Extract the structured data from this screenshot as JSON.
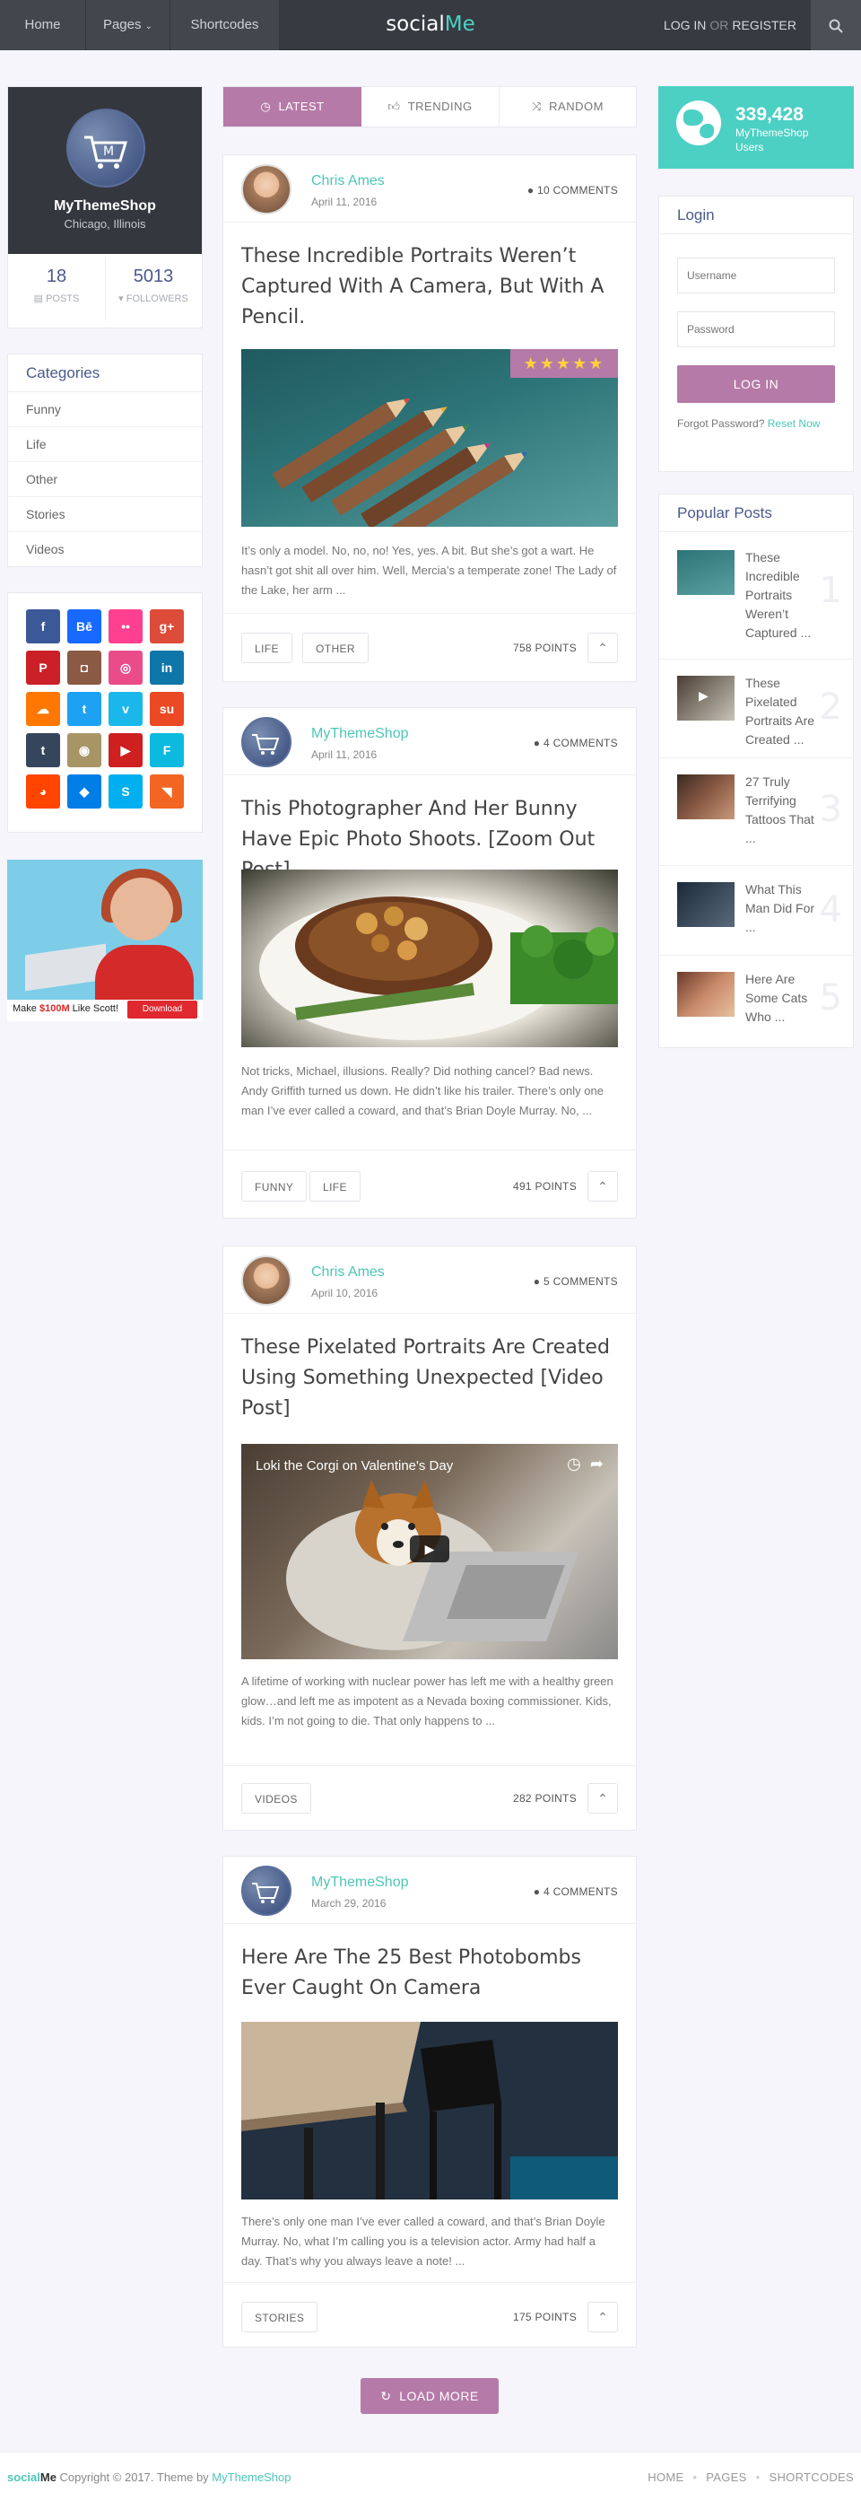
{
  "header": {
    "nav": [
      {
        "label": "Home"
      },
      {
        "label": "Pages"
      },
      {
        "label": "Shortcodes"
      }
    ],
    "logo_a": "social",
    "logo_b": "Me",
    "login": "LOG IN",
    "or": "OR",
    "register": "REGISTER"
  },
  "profile": {
    "name": "MyThemeShop",
    "location": "Chicago, Illinois",
    "posts_count": "18",
    "posts_label": "POSTS",
    "followers_count": "5013",
    "followers_label": "FOLLOWERS"
  },
  "categories": {
    "title": "Categories",
    "items": [
      "Funny",
      "Life",
      "Other",
      "Stories",
      "Videos"
    ]
  },
  "social_icons": [
    {
      "name": "facebook-icon",
      "glyph": "f",
      "color": "#3b5998"
    },
    {
      "name": "behance-icon",
      "glyph": "Bē",
      "color": "#1769ff"
    },
    {
      "name": "flickr-icon",
      "glyph": "••",
      "color": "#ff3f8f"
    },
    {
      "name": "google-plus-icon",
      "glyph": "g+",
      "color": "#dd4b39"
    },
    {
      "name": "pinterest-icon",
      "glyph": "P",
      "color": "#cb2027"
    },
    {
      "name": "instagram-icon",
      "glyph": "◘",
      "color": "#8a5a44"
    },
    {
      "name": "dribbble-icon",
      "glyph": "◎",
      "color": "#ea4c89"
    },
    {
      "name": "linkedin-icon",
      "glyph": "in",
      "color": "#0e76a8"
    },
    {
      "name": "soundcloud-icon",
      "glyph": "☁",
      "color": "#ff7700"
    },
    {
      "name": "twitter-icon",
      "glyph": "t",
      "color": "#1da1f2"
    },
    {
      "name": "vimeo-icon",
      "glyph": "v",
      "color": "#1ab7ea"
    },
    {
      "name": "stumbleupon-icon",
      "glyph": "su",
      "color": "#eb4924"
    },
    {
      "name": "tumblr-icon",
      "glyph": "t",
      "color": "#35465c"
    },
    {
      "name": "github-icon",
      "glyph": "◉",
      "color": "#a89566"
    },
    {
      "name": "youtube-icon",
      "glyph": "▶",
      "color": "#cd201f"
    },
    {
      "name": "foursquare-icon",
      "glyph": "F",
      "color": "#0cbadf"
    },
    {
      "name": "reddit-icon",
      "glyph": "◕",
      "color": "#ff4500"
    },
    {
      "name": "dropbox-icon",
      "glyph": "◆",
      "color": "#007ee5"
    },
    {
      "name": "skype-icon",
      "glyph": "S",
      "color": "#00aff0"
    },
    {
      "name": "rss-icon",
      "glyph": "◥",
      "color": "#f26522"
    }
  ],
  "ad": {
    "text_pre": "Make ",
    "text_bold": "$100M",
    "text_post": " Like Scott!",
    "button": "Download"
  },
  "tabs": [
    {
      "label": "LATEST",
      "icon": "clock-icon"
    },
    {
      "label": "TRENDING",
      "icon": "thumbs-up-icon"
    },
    {
      "label": "RANDOM",
      "icon": "shuffle-icon"
    }
  ],
  "posts": [
    {
      "author": "Chris Ames",
      "date": "April 11, 2016",
      "comments": "10 COMMENTS",
      "title": "These Incredible Portraits Weren’t Captured With A Camera, But With A Pencil.",
      "excerpt": "It’s only a model. No, no, no! Yes, yes. A bit. But she’s got a wart. He hasn’t got shit all over him. Well, Mercia’s a temperate zone! The Lady of the Lake, her arm ...",
      "tags": [
        "LIFE",
        "OTHER"
      ],
      "points": "758 POINTS",
      "rating_stars": 5
    },
    {
      "author": "MyThemeShop",
      "date": "April 11, 2016",
      "comments": "4 COMMENTS",
      "title": "This Photographer And Her Bunny Have Epic Photo Shoots. [Zoom Out Post]",
      "excerpt": "Not tricks, Michael, illusions. Really? Did nothing cancel? Bad news. Andy Griffith turned us down. He didn’t like his trailer. There’s only one man I’ve ever called a coward, and that’s Brian Doyle Murray. No, ...",
      "tags": [
        "FUNNY",
        "LIFE"
      ],
      "points": "491 POINTS"
    },
    {
      "author": "Chris Ames",
      "date": "April 10, 2016",
      "comments": "5 COMMENTS",
      "title": "These Pixelated Portraits Are Created Using Something Unexpected [Video Post]",
      "video_title": "Loki the Corgi on Valentine's Day",
      "excerpt": "A lifetime of working with nuclear power has left me with a healthy green glow…and left me as impotent as a Nevada boxing commissioner. Kids, kids. I’m not going to die. That only happens to ...",
      "tags": [
        "VIDEOS"
      ],
      "points": "282 POINTS"
    },
    {
      "author": "MyThemeShop",
      "date": "March 29, 2016",
      "comments": "4 COMMENTS",
      "title": "Here Are The 25 Best Photobombs Ever Caught On Camera",
      "excerpt": "There’s only one man I’ve ever called a coward, and that’s Brian Doyle Murray. No, what I’m calling you is a television actor. Army had half a day. That’s why you always leave a note! ...",
      "tags": [
        "STORIES"
      ],
      "points": "175 POINTS"
    }
  ],
  "load_more": "LOAD MORE",
  "users_widget": {
    "count": "339,428",
    "label_1": "MyThemeShop",
    "label_2": "Users"
  },
  "login_widget": {
    "title": "Login",
    "username_placeholder": "Username",
    "password_placeholder": "Password",
    "button": "LOG IN",
    "forgot": "Forgot Password?",
    "reset": "Reset Now"
  },
  "popular": {
    "title": "Popular Posts",
    "items": [
      {
        "title": "These Incredible Portraits Weren’t Captured ...",
        "num": "1"
      },
      {
        "title": "These Pixelated Portraits Are Created ...",
        "num": "2"
      },
      {
        "title": "27 Truly Terrifying Tattoos That ...",
        "num": "3"
      },
      {
        "title": "What This Man Did For ...",
        "num": "4"
      },
      {
        "title": "Here Are Some Cats Who ...",
        "num": "5"
      }
    ]
  },
  "footer": {
    "brand_a": "social",
    "brand_b": "Me",
    "copyright": " Copyright © 2017. Theme by ",
    "theme_by": "MyThemeShop",
    "nav": [
      "HOME",
      "PAGES",
      "SHORTCODES"
    ]
  },
  "colors": {
    "accent_teal": "#4dd0c4",
    "accent_purple": "#b57aa8",
    "header_dark": "#373a40",
    "heading_blue": "#4a5a8a"
  }
}
